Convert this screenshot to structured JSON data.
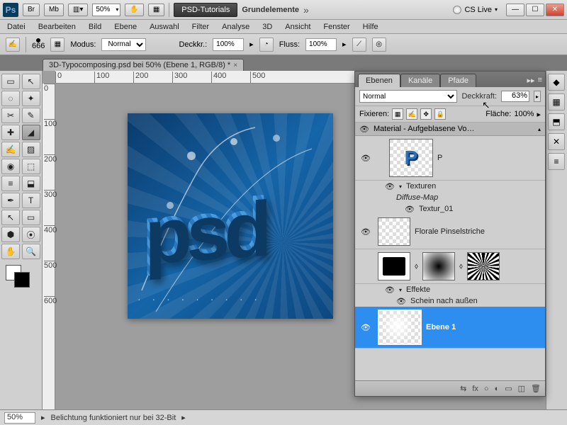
{
  "titlebar": {
    "app": "Ps",
    "br": "Br",
    "mb": "Mb",
    "zoom": "50%",
    "tutorials": "PSD-Tutorials",
    "doc_name": "Grundelemente",
    "cslive": "CS Live"
  },
  "menu": [
    "Datei",
    "Bearbeiten",
    "Bild",
    "Ebene",
    "Auswahl",
    "Filter",
    "Analyse",
    "3D",
    "Ansicht",
    "Fenster",
    "Hilfe"
  ],
  "options": {
    "brush_size": "666",
    "mode_label": "Modus:",
    "mode_value": "Normal",
    "opacity_label": "Deckkr.:",
    "opacity_value": "100%",
    "flow_label": "Fluss:",
    "flow_value": "100%"
  },
  "document_tab": "3D-Typocomposing.psd bei 50% (Ebene 1, RGB/8) *",
  "ruler_h": [
    "0",
    "100",
    "200",
    "300",
    "400",
    "500"
  ],
  "ruler_v": [
    "0",
    "100",
    "200",
    "300",
    "400",
    "500",
    "600"
  ],
  "layers_panel": {
    "tabs": [
      "Ebenen",
      "Kanäle",
      "Pfade"
    ],
    "blend_mode": "Normal",
    "opacity_label": "Deckkraft:",
    "opacity_value": "63%",
    "lock_label": "Fixieren:",
    "fill_label": "Fläche:",
    "fill_value": "100%",
    "group_header": "Material - Aufgeblasene Vo…",
    "layer_p": "P",
    "textures": "Texturen",
    "diffuse": "Diffuse-Map",
    "textur01": "Textur_01",
    "floral": "Florale Pinselstriche",
    "effects": "Effekte",
    "outer_glow": "Schein nach außen",
    "ebene1": "Ebene 1",
    "foot_icons": [
      "⇆",
      "fx",
      "○",
      "◐",
      "▭",
      "◫",
      "🗑"
    ]
  },
  "status": {
    "zoom": "50%",
    "msg": "Belichtung funktioniert nur bei 32-Bit"
  },
  "tool_glyphs": [
    "▭",
    "↖",
    "◌",
    "✦",
    "✂",
    "✎",
    "✚",
    "◢",
    "✍",
    "▨",
    "◉",
    "⬚",
    "≡",
    "⬓",
    "△",
    "◑",
    "∅",
    "○",
    "⊕",
    "◧",
    "✒",
    "T",
    "↖",
    "▭",
    "✋",
    "🔍"
  ]
}
